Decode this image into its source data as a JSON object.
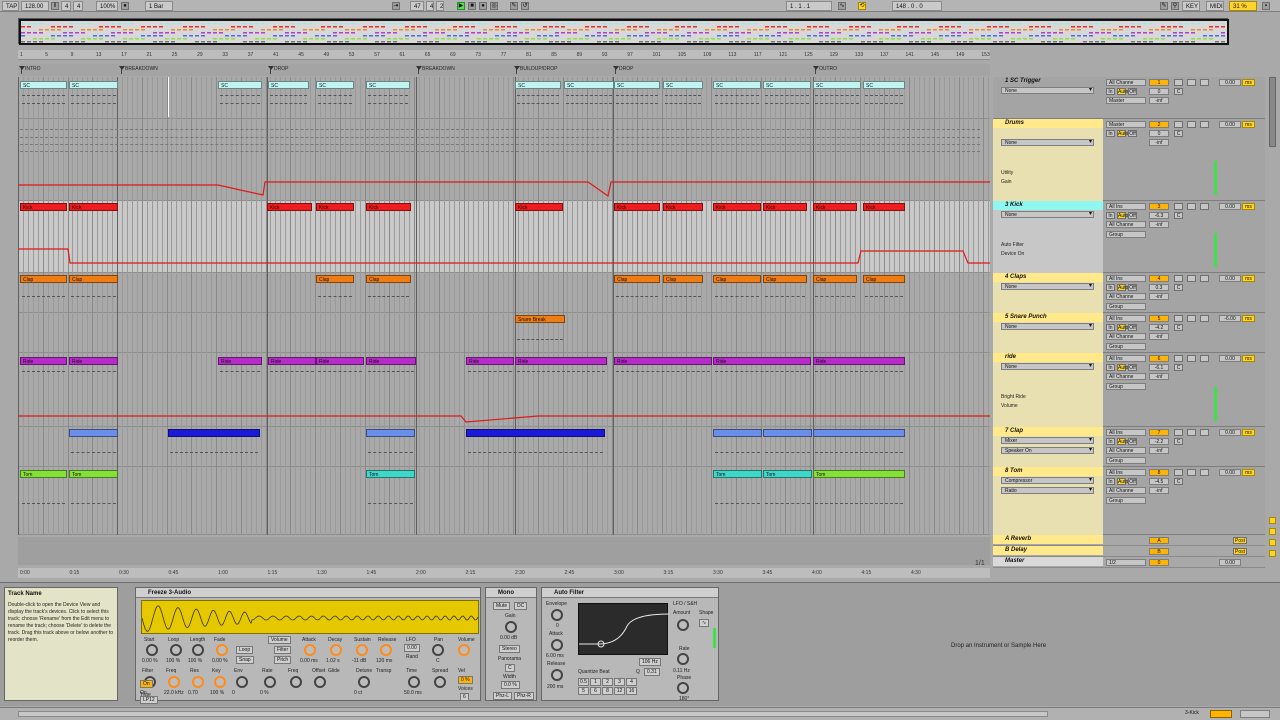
{
  "transport": {
    "tap": "TAP",
    "tempo": "128.00",
    "sig_num": "4",
    "sig_den": "4",
    "zoom": "100%",
    "quant": "1 Bar",
    "pos_bar": "47",
    "pos_beat": "4",
    "pos_sixteenth": "2",
    "loop_start": "1 . 1 . 1",
    "loop_len": "148 . 0 . 0",
    "key": "KEY",
    "midi": "MIDI",
    "cpu": "31 %"
  },
  "ruler_ticks": [
    "1",
    "5",
    "9",
    "13",
    "17",
    "21",
    "25",
    "29",
    "33",
    "37",
    "41",
    "45",
    "49",
    "53",
    "57",
    "61",
    "65",
    "69",
    "73",
    "77",
    "81",
    "85",
    "89",
    "93",
    "97",
    "101",
    "105",
    "109",
    "113",
    "117",
    "121",
    "125",
    "129",
    "133",
    "137",
    "141",
    "145",
    "149",
    "153"
  ],
  "locators": [
    {
      "label": "INTRO"
    },
    {
      "label": "BREAKDOWN"
    },
    {
      "label": "DROP"
    },
    {
      "label": "BREAKDOWN"
    },
    {
      "label": "BUILDUP/DROP"
    },
    {
      "label": "DROP"
    },
    {
      "label": "OUTRO"
    }
  ],
  "time_ticks": [
    "0:00",
    "0:15",
    "0:30",
    "0:45",
    "1:00",
    "1:15",
    "1:30",
    "1:45",
    "2:00",
    "2:15",
    "2:30",
    "2:45",
    "3:00",
    "3:15",
    "3:30",
    "3:45",
    "4:00",
    "4:15",
    "4:30"
  ],
  "zoom_page": "1/1",
  "tracks": [
    {
      "name": "1 SC Trigger",
      "sub": "None",
      "io1": "All Channe",
      "io2": "Master",
      "num": "1",
      "val": "0",
      "vol": "0.00",
      "ms": "ms"
    },
    {
      "name": "Drums",
      "sub": "None",
      "io1": "Master",
      "io2": "",
      "num": "2",
      "val": "0",
      "vol": "0.00",
      "ms": "ms",
      "dev": "Utility",
      "param": "Gain"
    },
    {
      "name": "3 Kick",
      "sub": "None",
      "io1": "All Ins",
      "io2": "All Channe",
      "num": "3",
      "val": "-6.3",
      "vol": "0.00",
      "ms": "ms",
      "dev": "Auto Filter",
      "param": "Device On"
    },
    {
      "name": "4 Claps",
      "sub": "None",
      "io1": "All Ins",
      "io2": "All Channe",
      "num": "4",
      "val": "0.3",
      "vol": "0.00",
      "ms": "ms"
    },
    {
      "name": "5 Snare Punch",
      "sub": "None",
      "io1": "All Ins",
      "io2": "All Channe",
      "num": "5",
      "val": "-4.2",
      "vol": "-6.00",
      "ms": "ms"
    },
    {
      "name": "ride",
      "sub": "None",
      "io1": "All Ins",
      "io2": "All Channe",
      "num": "6",
      "val": "-6.1",
      "vol": "0.00",
      "ms": "ms",
      "dev": "Bright Ride",
      "param": "Volume"
    },
    {
      "name": "7 Clap",
      "sub": "Mixer",
      "io1": "All Ins",
      "io2": "All Channe",
      "num": "7",
      "val": "-2.2",
      "vol": "0.00",
      "ms": "ms",
      "param2": "Speaker On"
    },
    {
      "name": "8 Tom",
      "sub": "Compressor",
      "io1": "All Ins",
      "io2": "All Channe",
      "num": "8",
      "val": "-4.5",
      "vol": "0.00",
      "ms": "ms",
      "param2": "Ratio"
    }
  ],
  "group_label": "Group",
  "in_label": "In",
  "auto_label": "Auto",
  "off_label": "Off",
  "inf_label": "-inf",
  "c_label": "C",
  "returns": [
    {
      "name": "A Reverb",
      "num": "A",
      "post": "Post"
    },
    {
      "name": "B Delay",
      "num": "B",
      "post": "Post"
    },
    {
      "name": "Master",
      "io": "1/2",
      "num": "0",
      "vol": "0.00"
    }
  ],
  "clips": {
    "sc": "SC",
    "kick": "Kick",
    "clap": "Clap",
    "snare": "Snare Break",
    "ride": "Ride",
    "tom": "Tom"
  },
  "colors": {
    "sc": "#bff4f0",
    "kick": "#ee1c1c",
    "clap": "#ef7d16",
    "snare": "#ef7d16",
    "ride": "#b52cc7",
    "clap7_light": "#6b8fe8",
    "clap7_dark": "#1a1ad8",
    "tom_green": "#86e03a",
    "tom_teal": "#3fd7c8",
    "drums_hdr": "#ffe98a",
    "kick_hdr": "#8ff7f0",
    "accent": "#ffb400",
    "automation": "#e01818"
  },
  "info": {
    "title": "Track Name",
    "body": "Double-click to open the Device View and display the track's devices. Click to select this track; choose 'Rename' from the Edit menu to rename the track; choose 'Delete' to delete the track. Drag this track above or below another to reorder them."
  },
  "freeze": {
    "title": "Freeze 3-Audio",
    "knobs": [
      {
        "label": "Start",
        "val": "0.00 %"
      },
      {
        "label": "Loop",
        "val": "100 %"
      },
      {
        "label": "Length",
        "val": "100 %"
      },
      {
        "label": "Fade",
        "val": "0.00 %"
      },
      {
        "label": "Attack",
        "val": "0.00 ms"
      },
      {
        "label": "Decay",
        "val": "1.02 s"
      },
      {
        "label": "Sustain",
        "val": "-11 dB"
      },
      {
        "label": "Release",
        "val": "120 ms"
      }
    ],
    "row2": [
      {
        "label": "Filter",
        "val": "On"
      },
      {
        "label": "Freq",
        "val": "22.0 kHz"
      },
      {
        "label": "Res",
        "val": "0.70"
      },
      {
        "label": "Key",
        "val": "100 %"
      },
      {
        "label": "Env",
        "val": "0"
      },
      {
        "label": "Rate",
        "val": "0 %"
      },
      {
        "label": "Freq",
        "val": ""
      },
      {
        "label": "Offset",
        "val": ""
      },
      {
        "label": "Detune",
        "val": "0 ct"
      },
      {
        "label": "Time",
        "val": "50.0 ms"
      }
    ],
    "volume": "Volume",
    "filter": "Filter",
    "pitch": "Pitch",
    "loop_btn": "Loop",
    "snap_btn": "Snap",
    "type": "Type",
    "type_val": "LP12",
    "lfo": "LFO",
    "lfo_val": "0.00",
    "vol_label": "Volume",
    "vel": "Vel",
    "vel_val": "0 %",
    "pan": "Pan",
    "pan_val": "C",
    "spread": "Spread",
    "glide": "Glide",
    "transp": "Transp",
    "rand": "Rand",
    "voices": "Voices",
    "voices_val": "6"
  },
  "mono": {
    "title": "Mono",
    "mute": "Mute",
    "dc": "DC",
    "gain": "Gain",
    "gain_val": "0.00 dB",
    "stereo": "Stereo",
    "panorama": "Panorama",
    "pan_val": "C",
    "width": "Width",
    "width_val": "0.0 %",
    "ph_l": "Phz-L",
    "ph_r": "Phz-R"
  },
  "autofilter": {
    "title": "Auto Filter",
    "envelope": "Envelope",
    "env_val": "0",
    "attack": "Attack",
    "attack_val": "6.00 ms",
    "release": "Release",
    "release_val": "200 ms",
    "freq_val": "106 Hz",
    "q_val": "0.31",
    "quantize": "Quantize Beat",
    "lfo": "LFO / S&H",
    "amount": "Amount",
    "shape": "Shape",
    "rate": "Rate",
    "rate_val": "0.11 Hz",
    "phase": "Phase",
    "phase_val": "180°",
    "q_label": "Q",
    "beats": [
      "0.5",
      "1",
      "2",
      "3",
      "4",
      "5",
      "6",
      "8",
      "12",
      "16"
    ]
  },
  "drop_hint": "Drop an Instrument or Sample Here",
  "status": {
    "track": "3-Kick"
  }
}
